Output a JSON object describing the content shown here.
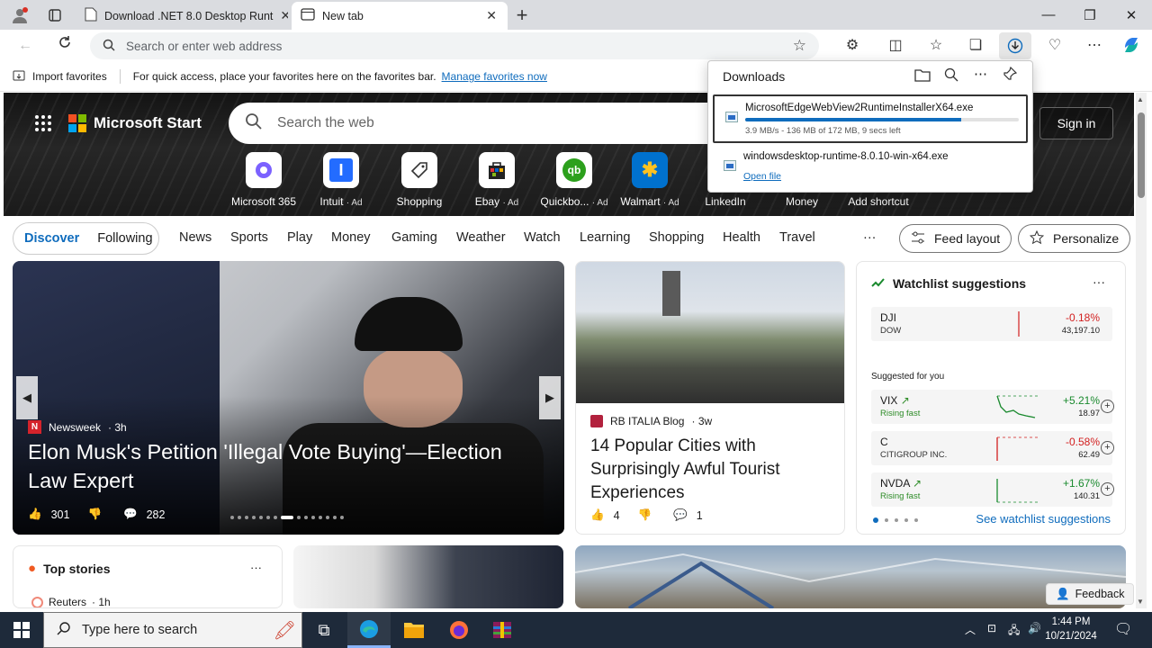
{
  "browser": {
    "tabs": [
      {
        "label": "Download .NET 8.0 Desktop Runt",
        "active": false
      },
      {
        "label": "New tab",
        "active": true
      }
    ],
    "address_placeholder": "Search or enter web address"
  },
  "favorites_bar": {
    "import_label": "Import favorites",
    "hint_text": "For quick access, place your favorites here on the favorites bar.",
    "manage_link": "Manage favorites now"
  },
  "ms_start": {
    "brand": "Microsoft Start",
    "search_placeholder": "Search the web",
    "sign_in": "Sign in",
    "shortcuts": [
      {
        "label": "Microsoft 365",
        "ad": ""
      },
      {
        "label": "Intuit",
        "ad": "· Ad"
      },
      {
        "label": "Shopping",
        "ad": ""
      },
      {
        "label": "Ebay",
        "ad": "· Ad"
      },
      {
        "label": "Quickbo...",
        "ad": "· Ad"
      },
      {
        "label": "Walmart",
        "ad": "· Ad"
      },
      {
        "label": "LinkedIn",
        "ad": ""
      },
      {
        "label": "Money",
        "ad": ""
      },
      {
        "label": "Add shortcut",
        "ad": ""
      }
    ]
  },
  "nav": {
    "discover": "Discover",
    "following": "Following",
    "links": [
      "News",
      "Sports",
      "Play",
      "Money",
      "Gaming",
      "Weather",
      "Watch",
      "Learning",
      "Shopping",
      "Health",
      "Travel"
    ],
    "more": "···",
    "feed_layout": "Feed layout",
    "personalize": "Personalize"
  },
  "featured": {
    "source": "Newsweek",
    "age": "· 3h",
    "title": "Elon Musk's Petition 'Illegal Vote Buying'—Election Law Expert",
    "likes": "301",
    "comments": "282"
  },
  "card2": {
    "source": "RB ITALIA Blog",
    "age": "· 3w",
    "title": "14 Popular Cities with Surprisingly Awful Tourist Experiences",
    "likes": "4",
    "comments": "1"
  },
  "watchlist": {
    "title": "Watchlist suggestions",
    "more": "···",
    "top": {
      "symbol": "DJI",
      "name": "DOW",
      "change": "-0.18%",
      "price": "43,197.10"
    },
    "suggested_label": "Suggested for you",
    "items": [
      {
        "symbol": "VIX",
        "sub": "Rising fast",
        "change": "+5.21%",
        "price": "18.97"
      },
      {
        "symbol": "C",
        "sub": "CITIGROUP INC.",
        "change": "-0.58%",
        "price": "62.49"
      },
      {
        "symbol": "NVDA",
        "sub": "Rising fast",
        "change": "+1.67%",
        "price": "140.31"
      }
    ],
    "see_link": "See watchlist suggestions"
  },
  "top_stories": {
    "title": "Top stories",
    "more": "···",
    "source": "Reuters",
    "age": "· 1h"
  },
  "feedback_label": "Feedback",
  "downloads": {
    "title": "Downloads",
    "items": [
      {
        "file": "MicrosoftEdgeWebView2RuntimeInstallerX64.exe",
        "status": "3.9 MB/s - 136 MB of 172 MB, 9 secs left",
        "progress": 0.79
      },
      {
        "file": "windowsdesktop-runtime-8.0.10-win-x64.exe",
        "action": "Open file"
      }
    ]
  },
  "taskbar": {
    "search_placeholder": "Type here to search",
    "time": "1:44 PM",
    "date": "10/21/2024"
  },
  "colors": {
    "accent": "#0f6cbd",
    "negative": "#d21f1f",
    "positive": "#1a8a2e"
  }
}
